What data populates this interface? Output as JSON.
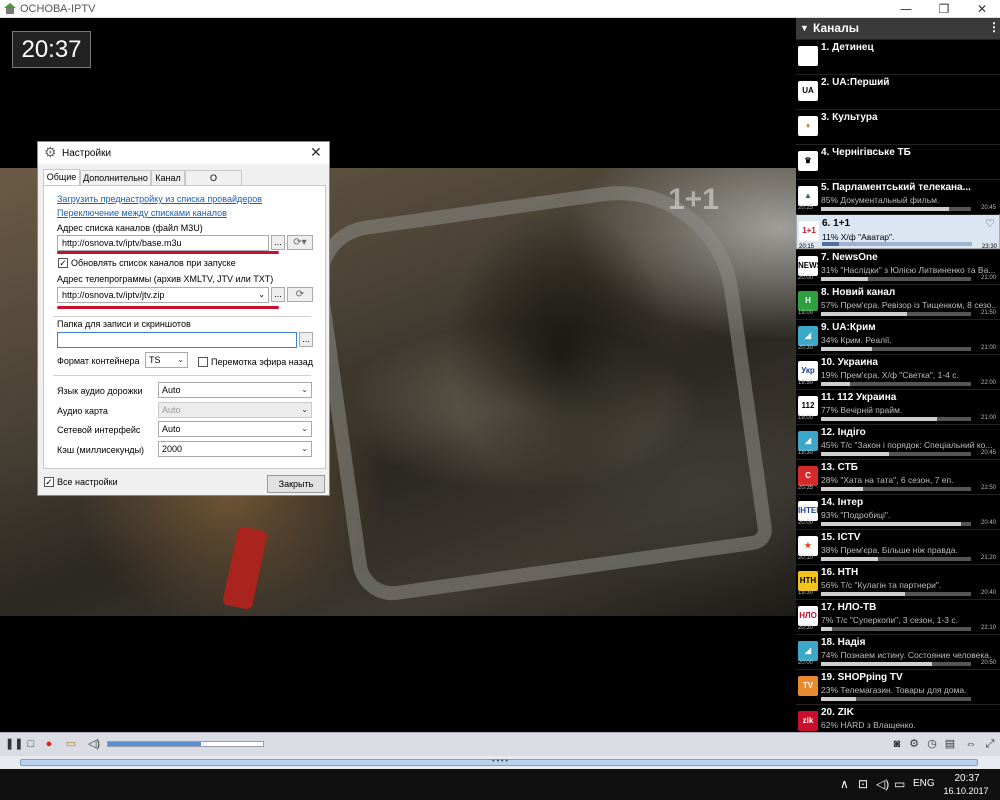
{
  "window": {
    "title": "ОСНОВА-IPTV",
    "min": "—",
    "max": "❐",
    "close": "✕"
  },
  "player": {
    "clock": "20:37",
    "watermark": "1+1",
    "volume_fraction": 0.6
  },
  "dialog": {
    "title": "Настройки",
    "tabs": [
      "Общие",
      "Дополнительно",
      "Канал",
      "О программе"
    ],
    "link_presets": "Загрузить преднастройку из списка провайдеров",
    "link_switch": "Переключение между списками каналов",
    "playlist_label": "Адрес списка каналов (файл M3U)",
    "playlist_value": "http://osnova.tv/iptv/base.m3u",
    "update_label": "Обновлять список каналов при запуске",
    "epg_label": "Адрес телепрограммы (архив XMLTV, JTV или TXT)",
    "epg_value": "http://osnova.tv/iptv/jtv.zip",
    "record_label": "Папка для записи и скриншотов",
    "record_value": "",
    "container_label": "Формат контейнера",
    "container_value": "TS",
    "rewind_label": "Перемотка эфира назад",
    "audio_track_label": "Язык аудио дорожки",
    "audio_track_value": "Auto",
    "audio_card_label": "Аудио карта",
    "audio_card_value": "Auto",
    "net_label": "Сетевой интерфейс",
    "net_value": "Auto",
    "cache_label": "Кэш (миллисекунды)",
    "cache_value": "2000",
    "all_settings_label": "Все настройки",
    "close_label": "Закрыть",
    "browse": "...",
    "update_checked": "✓",
    "all_checked": "✓"
  },
  "channels_header": "Каналы",
  "channels": [
    {
      "name": "1. Детинец",
      "info": "",
      "start": "",
      "end": "",
      "progress": 0,
      "logo_text": "",
      "logo_bg": "#ffffff",
      "logo_fg": "#c00000"
    },
    {
      "name": "2. UA:Перший",
      "info": "",
      "start": "",
      "end": "",
      "progress": 0,
      "logo_text": "UA",
      "logo_bg": "#ffffff",
      "logo_fg": "#000000"
    },
    {
      "name": "3. Культура",
      "info": "",
      "start": "",
      "end": "",
      "progress": 0,
      "logo_text": "♦",
      "logo_bg": "#ffffff",
      "logo_fg": "#c28b2c"
    },
    {
      "name": "4. Чернігівське ТБ",
      "info": "",
      "start": "",
      "end": "",
      "progress": 0,
      "logo_text": "♛",
      "logo_bg": "#ffffff",
      "logo_fg": "#000000"
    },
    {
      "name": "5. Парламентський телекана...",
      "info": "85% Документальный фильм.",
      "start": "20:25",
      "end": "20:45",
      "progress": 0.85,
      "logo_text": "▲",
      "logo_bg": "#ffffff",
      "logo_fg": "#2b6e3a"
    },
    {
      "name": "6. 1+1",
      "info": "11% Х/ф \"Аватар\".",
      "start": "20:15",
      "end": "23:30",
      "progress": 0.11,
      "logo_text": "1+1",
      "logo_bg": "#ffffff",
      "logo_fg": "#c8102e",
      "selected": true
    },
    {
      "name": "7. NewsOne",
      "info": "31% \"Наслідки\" з Юлією Литвиненко та Ва...",
      "start": "20:00",
      "end": "21:00",
      "progress": 0.31,
      "logo_text": "NEWS",
      "logo_bg": "#ffffff",
      "logo_fg": "#000000"
    },
    {
      "name": "8. Новий канал",
      "info": "57% Прем'єра. Ревізор із Тищенком, 8 сезо...",
      "start": "19:00",
      "end": "21:50",
      "progress": 0.57,
      "logo_text": "Н",
      "logo_bg": "#2e9e3e",
      "logo_fg": "#ffffff"
    },
    {
      "name": "9. UA:Крим",
      "info": "34% Крим. Реалії.",
      "start": "20:30",
      "end": "21:00",
      "progress": 0.34,
      "logo_text": "◢",
      "logo_bg": "#3ba7c9",
      "logo_fg": "#ffffff"
    },
    {
      "name": "10. Украина",
      "info": "19% Прем'єра. Х/ф \"Светка\", 1-4 с.",
      "start": "19:50",
      "end": "22:00",
      "progress": 0.19,
      "logo_text": "Укр",
      "logo_bg": "#ffffff",
      "logo_fg": "#1c3f8f"
    },
    {
      "name": "11. 112 Украина",
      "info": "77% Вечірній прайм.",
      "start": "19:00",
      "end": "21:00",
      "progress": 0.77,
      "logo_text": "112",
      "logo_bg": "#ffffff",
      "logo_fg": "#000000"
    },
    {
      "name": "12. Індіго",
      "info": "45% Т/с \"Закон і порядок: Спеціальний ко...",
      "start": "19:30",
      "end": "20:45",
      "progress": 0.45,
      "logo_text": "◢",
      "logo_bg": "#3ba7c9",
      "logo_fg": "#ffffff"
    },
    {
      "name": "13. СТБ",
      "info": "28% \"Хата на тата\", 6 сезон, 7 еп.",
      "start": "20:35",
      "end": "22:50",
      "progress": 0.28,
      "logo_text": "С",
      "logo_bg": "#d42a2a",
      "logo_fg": "#ffffff"
    },
    {
      "name": "14. Інтер",
      "info": "93% \"Подробиці\".",
      "start": "20:00",
      "end": "20:40",
      "progress": 0.93,
      "logo_text": "ІНТЕР",
      "logo_bg": "#ffffff",
      "logo_fg": "#1c3f8f"
    },
    {
      "name": "15. ICTV",
      "info": "38% Прем'єра. Більше ніж правда.",
      "start": "20:10",
      "end": "21:20",
      "progress": 0.38,
      "logo_text": "★",
      "logo_bg": "#ffffff",
      "logo_fg": "#e4421b"
    },
    {
      "name": "16. НТН",
      "info": "56% Т/с \"Кулагін та партнери\".",
      "start": "19:30",
      "end": "20:40",
      "progress": 0.56,
      "logo_text": "НТН",
      "logo_bg": "#f4c21d",
      "logo_fg": "#000000"
    },
    {
      "name": "17. НЛО-ТВ",
      "info": "7% Т/с \"Суперкопи\", 3 сезон, 1-3 с.",
      "start": "20:30",
      "end": "22:10",
      "progress": 0.07,
      "logo_text": "НЛО",
      "logo_bg": "#ffffff",
      "logo_fg": "#c8102e"
    },
    {
      "name": "18. Надія",
      "info": "74% Познаем истину. Состояние человека.",
      "start": "20:00",
      "end": "20:50",
      "progress": 0.74,
      "logo_text": "◢",
      "logo_bg": "#3ba7c9",
      "logo_fg": "#ffffff"
    },
    {
      "name": "19. SHOPping TV",
      "info": "23% Телемагазин. Товары для дома.",
      "start": "",
      "end": "",
      "progress": 0.23,
      "logo_text": "TV",
      "logo_bg": "#e98a2e",
      "logo_fg": "#ffffff"
    },
    {
      "name": "20. ZIK",
      "info": "62% HARD з Влащенко.",
      "start": "",
      "end": "",
      "progress": 0.62,
      "logo_text": "zik",
      "logo_bg": "#c8102e",
      "logo_fg": "#ffffff"
    }
  ],
  "taskbar": {
    "lang": "ENG",
    "time": "20:37",
    "date": "16.10.2017"
  }
}
